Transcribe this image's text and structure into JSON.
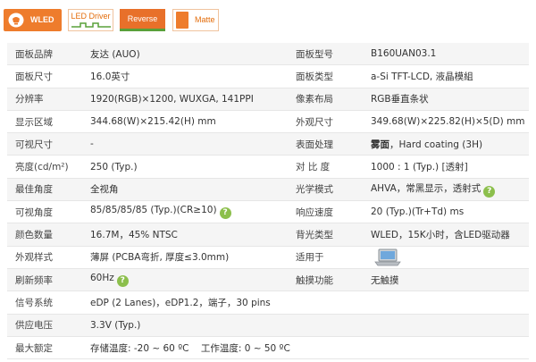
{
  "badges": [
    {
      "label": "WLED"
    },
    {
      "label": "LED Driver"
    },
    {
      "label": "Reverse"
    },
    {
      "label": "Matte"
    }
  ],
  "rows": [
    {
      "l1": "面板品牌",
      "v1": "友达 (AUO)",
      "l2": "面板型号",
      "v2": "B160UAN03.1"
    },
    {
      "l1": "面板尺寸",
      "v1": "16.0英寸",
      "l2": "面板类型",
      "v2": "a-Si TFT-LCD, 液晶模組"
    },
    {
      "l1": "分辨率",
      "v1": "1920(RGB)×1200, WUXGA, 141PPI",
      "l2": "像素布局",
      "v2": "RGB垂直条状"
    },
    {
      "l1": "显示区域",
      "v1": "344.68(W)×215.42(H) mm",
      "l2": "外观尺寸",
      "v2": "349.68(W)×225.82(H)×5(D) mm"
    },
    {
      "l1": "可视尺寸",
      "v1": "-",
      "l2": "表面处理",
      "v2_bold": "雾面",
      "v2": "，Hard coating (3H)"
    },
    {
      "l1": "亮度(cd/m²)",
      "v1": "250 (Typ.)",
      "l2": "对 比 度",
      "v2": "1000 : 1 (Typ.) [透射]"
    },
    {
      "l1": "最佳角度",
      "v1": "全视角",
      "l2": "光学模式",
      "v2": "AHVA，常黑显示，透射式"
    },
    {
      "l1": "可视角度",
      "v1": "85/85/85/85 (Typ.)(CR≥10)",
      "l2": "响应速度",
      "v2": "20 (Typ.)(Tr+Td) ms"
    },
    {
      "l1": "颜色数量",
      "v1": "16.7M，45% NTSC",
      "l2": "背光类型",
      "v2": "WLED，15K小时，含LED驱动器"
    },
    {
      "l1": "外观样式",
      "v1": "薄屏 (PCBA弯折, 厚度≤3.0mm)",
      "l2": "适用于",
      "v2": ""
    },
    {
      "l1": "刷新频率",
      "v1": "60Hz",
      "l2": "触摸功能",
      "v2": "无触摸"
    },
    {
      "l1": "信号系统",
      "v1": "eDP (2 Lanes)，eDP1.2，端子，30 pins"
    },
    {
      "l1": "供应电压",
      "v1": "3.3V (Typ.)"
    },
    {
      "l1": "最大额定",
      "v1": "存储温度: -20 ~ 60 ºC    工作温度: 0 ~ 50 ºC"
    }
  ],
  "icons": {
    "help": "?",
    "laptop": "laptop-icon"
  },
  "colors": {
    "accent": "#ee7c2c",
    "link": "#2b6fb6",
    "help": "#8cbf4c"
  }
}
